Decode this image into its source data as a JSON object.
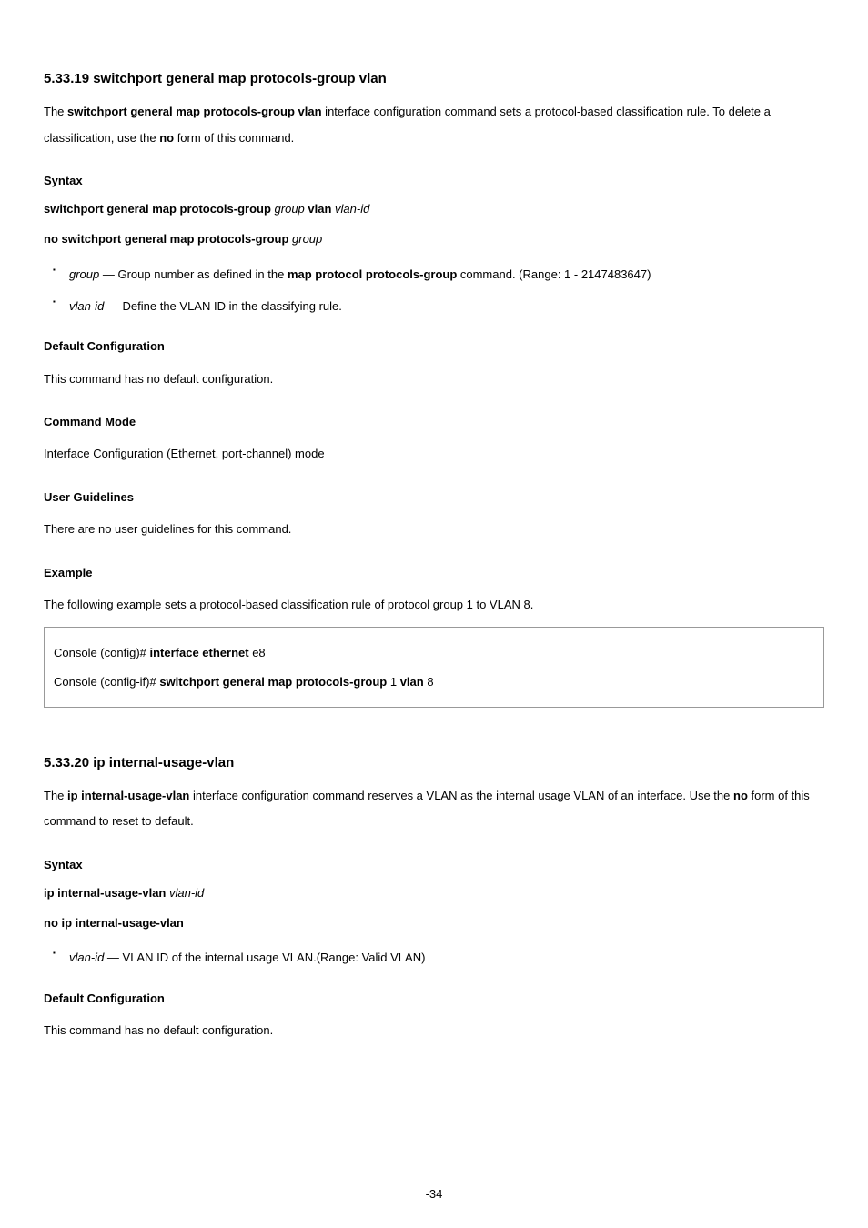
{
  "cmd1": {
    "title": "5.33.19 switchport general map protocols-group vlan",
    "intro_the": "The ",
    "intro_cmd": "switchport general map protocols-group vlan",
    "intro_rest": " interface configuration command sets a protocol-based classification rule. To delete a classification, use the ",
    "intro_no": "no",
    "intro_end": " form of this command.",
    "syntax_h": "Syntax",
    "syntax1_cmd": "switchport general map protocols-group ",
    "syntax1_arg1": "group ",
    "syntax1_mid": "vlan ",
    "syntax1_arg2": "vlan-id",
    "syntax2_cmd": "no switchport general map protocols-group ",
    "syntax2_arg": "group",
    "params": [
      {
        "arg": "group",
        "mid": " — Group number as defined in the ",
        "bold": "map protocol protocols-group",
        "end": " command. (Range: 1 - 2147483647)"
      },
      {
        "arg": "vlan-id",
        "mid": " — Define the VLAN ID in the classifying rule.",
        "bold": "",
        "end": ""
      }
    ],
    "def_h": "Default Configuration",
    "def_txt": "This command has no default configuration.",
    "mode_h": "Command Mode",
    "mode_txt": "Interface Configuration (Ethernet, port-channel) mode",
    "ug_h": "User Guidelines",
    "ug_txt": "There are no user guidelines for this command.",
    "ex_h": "Example",
    "ex_txt": "The following example sets a protocol-based classification rule of protocol group 1 to VLAN 8.",
    "code": {
      "l1a": "Console (config)# ",
      "l1b": "interface ethernet ",
      "l1c": "e8",
      "l2a": "Console (config-if)# ",
      "l2b": "switchport general map protocols-group ",
      "l2c": "1 ",
      "l2d": "vlan ",
      "l2e": "8"
    }
  },
  "cmd2": {
    "title": "5.33.20 ip internal-usage-vlan",
    "intro_the": "The ",
    "intro_cmd": "ip internal-usage-vlan",
    "intro_rest": " interface configuration command reserves a VLAN as the internal usage VLAN of an interface. Use the ",
    "intro_no": "no",
    "intro_end": " form of this command to reset to default.",
    "syntax_h": "Syntax",
    "syntax1_cmd": "ip internal-usage-vlan ",
    "syntax1_arg": "vlan-id",
    "syntax2_cmd": "no ip internal-usage-vlan",
    "params": [
      {
        "arg": "vlan-id — ",
        "txt": "VLAN ID of the internal usage VLAN.(Range: Valid VLAN)"
      }
    ],
    "def_h": "Default Configuration",
    "def_txt": "This command has no default configuration."
  },
  "page": "-34"
}
